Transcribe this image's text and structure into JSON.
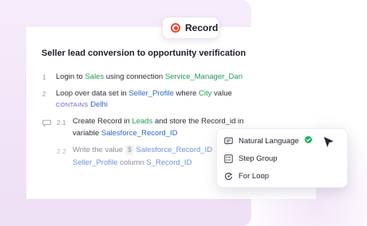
{
  "record_button": {
    "label": "Record"
  },
  "flow": {
    "title": "Seller lead conversion to opportunity verification",
    "steps": [
      {
        "num": "1",
        "parts": [
          "Login to ",
          "Sales",
          " using connection ",
          "Service_Manager_Dan"
        ]
      },
      {
        "num": "2",
        "parts": [
          "Loop over data set in ",
          "Seller_Profile",
          " where ",
          "City",
          " value"
        ],
        "line2": [
          "CONTAINS",
          "Delhi"
        ]
      },
      {
        "num": "2.1",
        "parts": [
          "Create Record in ",
          "Leads",
          " and store the Record_id in"
        ],
        "line2": [
          "variable ",
          "Salesforce_Record_ID"
        ]
      },
      {
        "num": "2.2",
        "parts": [
          "Write the value ",
          "$",
          "Salesforce_Record_ID"
        ],
        "line2": [
          "Seller_Profile",
          " column ",
          "S_Record_ID"
        ]
      }
    ]
  },
  "menu": {
    "items": [
      {
        "label": "Natural Language",
        "icon": "natural-language-icon",
        "verified": true
      },
      {
        "label": "Step Group",
        "icon": "step-group-icon"
      },
      {
        "label": "For Loop",
        "icon": "for-loop-icon"
      }
    ]
  },
  "colors": {
    "green": "#1f9d55",
    "blue": "#2f63c9",
    "record_red": "#e8462f",
    "contains_purple": "#6a5cd6",
    "background_pink": "#f1e4f7"
  }
}
